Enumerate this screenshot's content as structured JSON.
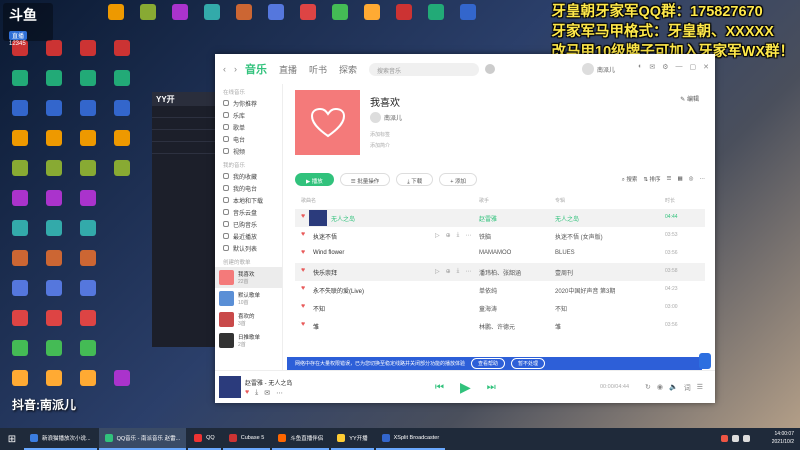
{
  "overlay": {
    "stream_logo": "斗鱼",
    "stream_sub": "直播",
    "stream_num": "12345",
    "line1": "牙皇朝牙家军QQ群：175827670",
    "line2": "牙家军马甲格式：牙皇朝、XXXXX",
    "line3": "改马甲10级牌子可加入牙家军WX群！",
    "douyin": "抖音:南派儿"
  },
  "background_app": {
    "title": "YY开"
  },
  "music": {
    "nav_back": "‹",
    "nav_forward": "›",
    "tabs": [
      "音乐",
      "直播",
      "听书",
      "探索"
    ],
    "search_placeholder": "搜索音乐",
    "user_name": "南派儿",
    "sidebar": {
      "online_title": "在线音乐",
      "online_items": [
        "为你推荐",
        "乐库",
        "歌单",
        "电台",
        "视频"
      ],
      "my_title": "我的音乐",
      "my_items": [
        "我的收藏",
        "我的电台",
        "本地和下载",
        "音乐云盘",
        "已购音乐",
        "最近播放",
        "默认列表"
      ],
      "created_title": "创建的歌单",
      "playlists": [
        {
          "title": "我喜欢",
          "sub": "22首"
        },
        {
          "title": "默认歌单",
          "sub": "10首"
        },
        {
          "title": "喜欢的",
          "sub": "3首"
        },
        {
          "title": "日推歌单",
          "sub": "2首"
        }
      ]
    },
    "playlist": {
      "title": "我喜欢",
      "creator": "南派儿",
      "meta1": "添加标签",
      "meta2": "添加简介",
      "edit_label": "编辑"
    },
    "actions": {
      "play": "播放",
      "batch": "批量操作",
      "download": "下载",
      "add": "添加",
      "search": "搜索",
      "sort": "排序"
    },
    "table_headers": {
      "song": "歌曲名",
      "artist": "歌手",
      "album": "专辑",
      "duration": "时长"
    },
    "songs": [
      {
        "title": "无人之岛",
        "artist": "赵雷雅",
        "album": "无人之岛",
        "duration": "04:44"
      },
      {
        "title": "执迷不悟",
        "artist": "铁脑",
        "album": "执迷不悟 (女声版)",
        "duration": "03:53"
      },
      {
        "title": "Wind flower",
        "artist": "MAMAMOO",
        "album": "BLUES",
        "duration": "03:56"
      },
      {
        "title": "快乐崇拜",
        "artist": "潘玮柏、张韶涵",
        "album": "壹周刊",
        "duration": "03:58"
      },
      {
        "title": "永不失联的爱(Live)",
        "artist": "单依纯",
        "album": "2020中国好声音 第3期",
        "duration": "04:23"
      },
      {
        "title": "不知",
        "artist": "童海涛",
        "album": "不知",
        "duration": "03:00"
      },
      {
        "title": "雏",
        "artist": "林鹏、许德元",
        "album": "雏",
        "duration": "03:56"
      }
    ],
    "notice": {
      "text": "网络中存在大量权限错误，已为您切换至稳定线路并关闭部分功能的播放体验",
      "btn1": "查看帮助",
      "btn2": "暂不处理"
    },
    "player": {
      "now_playing": "赵雷雅 - 无人之岛",
      "time": "00:00/04:44"
    }
  },
  "taskbar": {
    "items": [
      "新浪猫播放次小说...",
      "QQ音乐 - 南派音乐 赵雷...",
      "QQ",
      "Cubase 5",
      "斗鱼直播伴侣",
      "YY开播",
      "XSplit Broadcaster"
    ],
    "time": "14:00:07",
    "date": "2021/10/2"
  }
}
